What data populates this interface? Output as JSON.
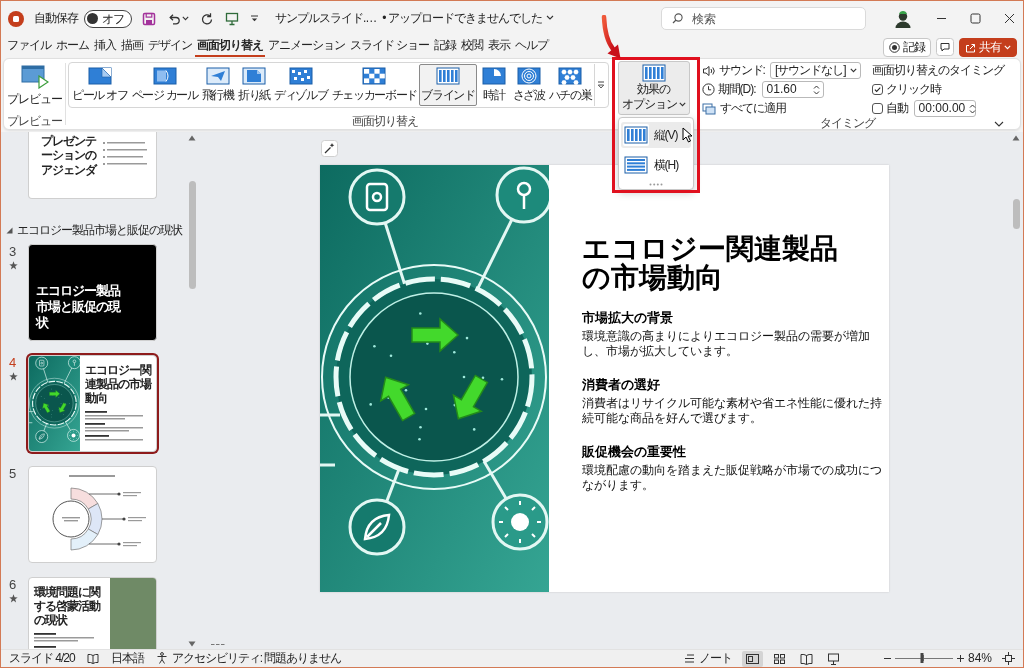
{
  "title_bar": {
    "autosave_label": "自動保存",
    "autosave": {
      "label": "オフ",
      "on": false
    },
    "file_name": "サンプルスライド.…",
    "upload_status": "• アップロードできませんでした",
    "search": {
      "placeholder": "検索"
    }
  },
  "menu_tabs": [
    {
      "label": "ファイル",
      "selected": false
    },
    {
      "label": "ホーム",
      "selected": false
    },
    {
      "label": "挿入",
      "selected": false
    },
    {
      "label": "描画",
      "selected": false
    },
    {
      "label": "デザイン",
      "selected": false
    },
    {
      "label": "画面切り替え",
      "selected": true
    },
    {
      "label": "アニメーション",
      "selected": false
    },
    {
      "label": "スライド ショー",
      "selected": false
    },
    {
      "label": "記録",
      "selected": false
    },
    {
      "label": "校閲",
      "selected": false
    },
    {
      "label": "表示",
      "selected": false
    },
    {
      "label": "ヘルプ",
      "selected": false
    }
  ],
  "header_buttons": {
    "record": "記録",
    "share": "共有"
  },
  "ribbon": {
    "preview": {
      "button": "プレビュー",
      "group_label": "プレビュー"
    },
    "transitions": {
      "group_label": "画面切り替え",
      "items": [
        {
          "kind": "peel",
          "label": "ピール オフ",
          "selected": false
        },
        {
          "kind": "curl",
          "label": "ページ カール",
          "selected": false
        },
        {
          "kind": "airplane",
          "label": "飛行機",
          "selected": false
        },
        {
          "kind": "origami",
          "label": "折り紙",
          "selected": false
        },
        {
          "kind": "dissolve",
          "label": "ディゾルブ",
          "selected": false
        },
        {
          "kind": "checkerboard",
          "label": "チェッカーボード",
          "selected": false
        },
        {
          "kind": "blinds",
          "label": "ブラインド",
          "selected": true
        },
        {
          "kind": "clock",
          "label": "時計",
          "selected": false
        },
        {
          "kind": "ripple",
          "label": "さざ波",
          "selected": false
        },
        {
          "kind": "honeycomb",
          "label": "ハチの巣",
          "selected": false
        }
      ]
    },
    "effect_options": {
      "label_lines": [
        "効果の",
        "オプション"
      ]
    },
    "sound": {
      "label": "サウンド:",
      "value": "[サウンドなし]"
    },
    "duration": {
      "label": "期間(D):",
      "value": "01.60"
    },
    "apply_all": {
      "label": "すべてに適用"
    },
    "timing": {
      "title": "画面切り替えのタイミング",
      "on_click": {
        "label": "クリック時",
        "checked": true
      },
      "after": {
        "label": "自動",
        "checked": false,
        "value": "00:00.00"
      },
      "group_label": "タイミング"
    }
  },
  "effect_menu": {
    "items": [
      {
        "kind": "vertical",
        "label": "縦(V)",
        "selected": true
      },
      {
        "kind": "horizontal",
        "label": "横(H)",
        "selected": false
      }
    ]
  },
  "slide_panel": {
    "items": [
      {
        "kind": "agenda_slide",
        "title": "プレゼンテーションのアジェンダ",
        "selected": false
      },
      {
        "kind": "section",
        "label": "エコロジー製品市場と販促の現状",
        "expanded": true,
        "selected": false
      },
      {
        "kind": "title_slide",
        "number": "3",
        "transition": true,
        "title": "エコロジー製品市場と販促の現状",
        "selected": false
      },
      {
        "kind": "image_left_slide",
        "number": "4",
        "transition": true,
        "title": "エコロジー関連製品の市場動向",
        "selected": true
      },
      {
        "kind": "diagram_slide",
        "number": "5",
        "transition": false,
        "selected": false
      },
      {
        "kind": "image_right_slide",
        "number": "6",
        "transition": true,
        "title": "環境問題に関する啓蒙活動の現状",
        "selected": false
      }
    ]
  },
  "slide": {
    "title": "エコロジー関連製品の市場動向",
    "sections": [
      {
        "heading": "市場拡大の背景",
        "body": "環境意識の高まりによりエコロジー製品の需要が増加し、市場が拡大しています。"
      },
      {
        "heading": "消費者の選好",
        "body": "消費者はリサイクル可能な素材や省エネ性能に優れた持続可能な商品を好んで選びます。"
      },
      {
        "heading": "販促機会の重要性",
        "body": "環境配慮の動向を踏まえた販促戦略が市場での成功につながります。"
      }
    ]
  },
  "status_bar": {
    "slide_counter": "スライド 4/20",
    "language": "日本語",
    "accessibility": "アクセシビリティ: 問題ありません",
    "notes": "ノート",
    "views": [
      {
        "kind": "normal",
        "selected": true
      },
      {
        "kind": "sorter",
        "selected": false
      },
      {
        "kind": "reading",
        "selected": false
      },
      {
        "kind": "slideshow",
        "selected": false
      }
    ],
    "zoom": {
      "level": 0.47,
      "reading": "84%"
    }
  }
}
